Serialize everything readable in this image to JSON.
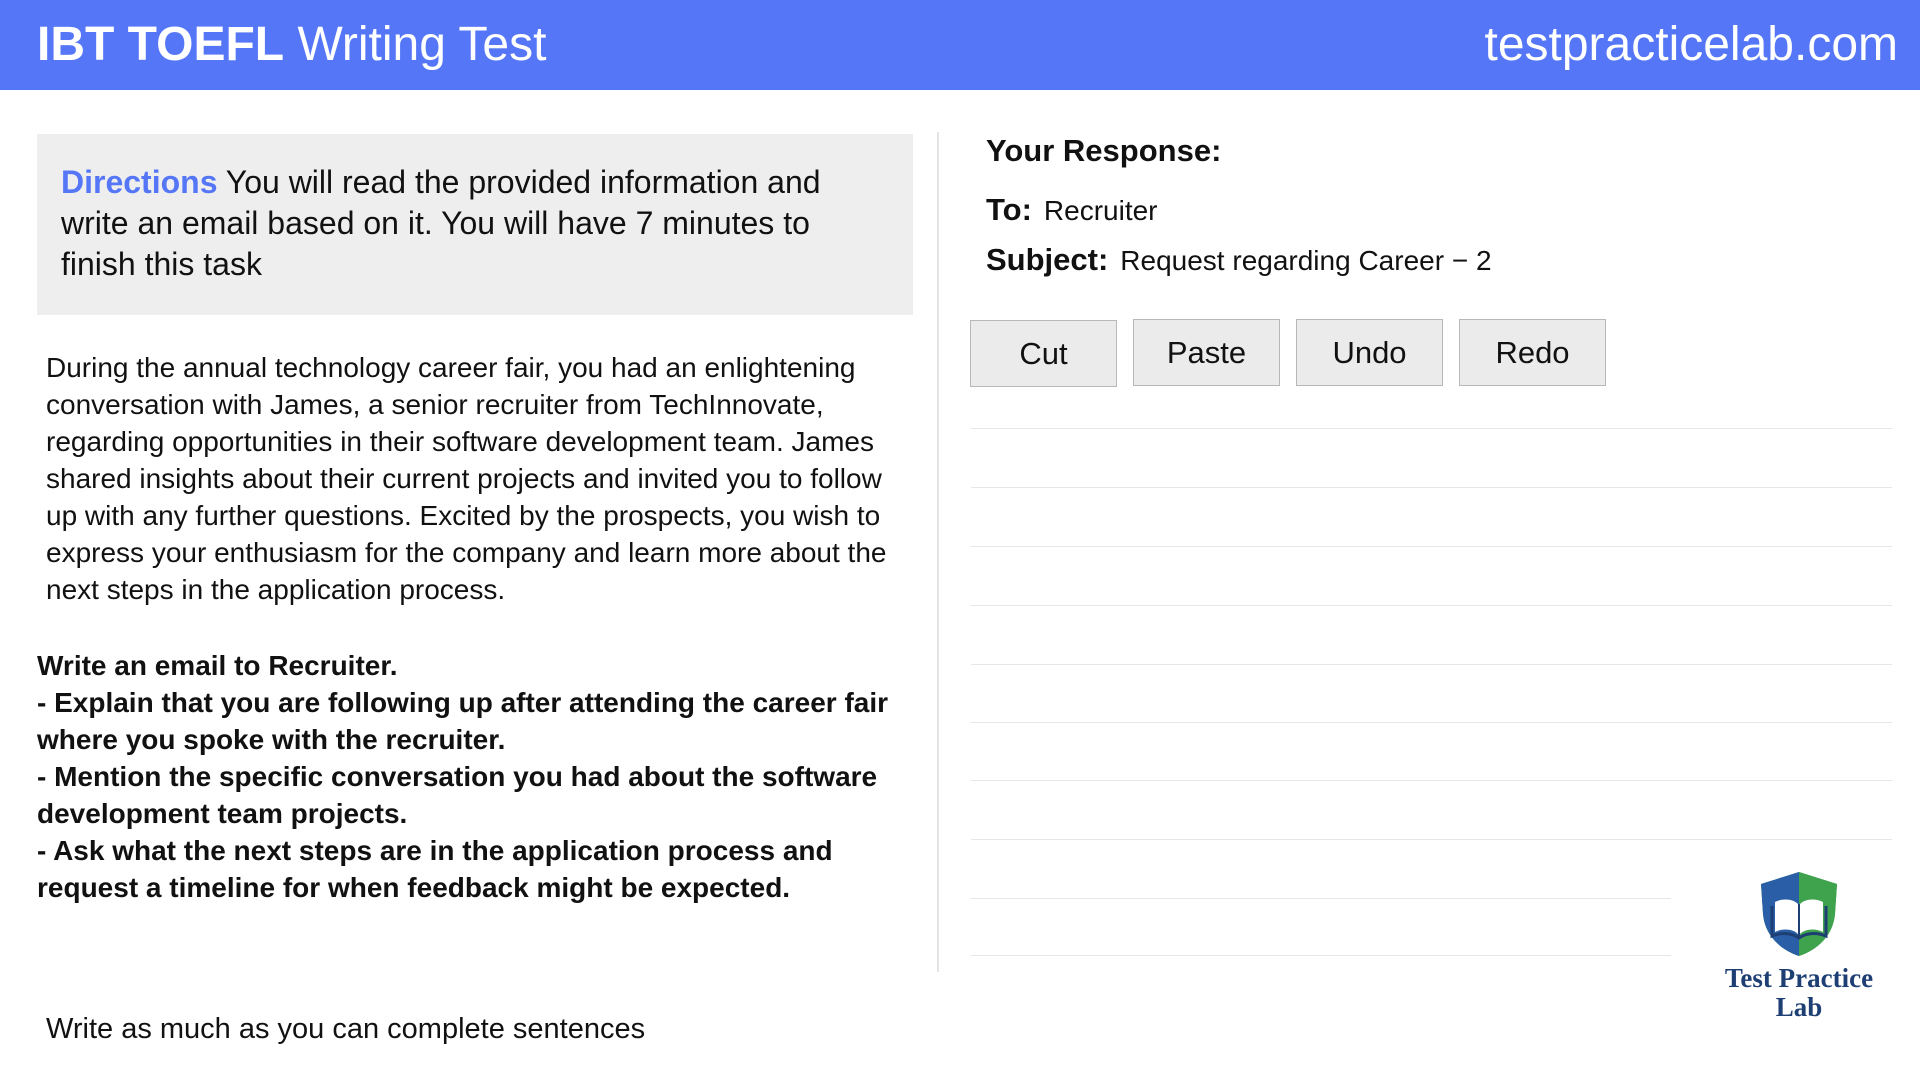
{
  "header": {
    "title_strong": "IBT TOEFL",
    "title_rest": " Writing Test",
    "site": "testpracticelab.com",
    "bar_color": "#5577f7"
  },
  "directions": {
    "label": "Directions",
    "text": " You will read the provided information and write an email based on it. You will have 7 minutes to finish this task"
  },
  "passage": "During the annual technology career fair, you had an enlightening conversation with James, a senior recruiter from TechInnovate, regarding opportunities in their software development team. James shared insights about their current projects and invited you to follow up with any further questions. Excited by the prospects, you wish to express your enthusiasm for the company and learn more about the next steps in the application process.",
  "instructions": {
    "heading": "Write an email to Recruiter.",
    "items": [
      "- Explain that you are following up after attending the career fair where you spoke with the recruiter.",
      "- Mention the specific conversation you had about the software development team projects.",
      "- Ask what the next steps are in the application process and request a timeline for when feedback might be expected."
    ]
  },
  "footer_note": "Write as much as you can complete sentences",
  "response": {
    "label": "Your Response:",
    "to_label": "To:",
    "to_value": "Recruiter",
    "subject_label": "Subject:",
    "subject_value": "Request regarding Career − 2",
    "body": ""
  },
  "toolbar": {
    "cut": "Cut",
    "paste": "Paste",
    "undo": "Undo",
    "redo": "Redo"
  },
  "logo": {
    "line1": "Test Practice",
    "line2": "Lab",
    "icon": "book-shield-icon"
  }
}
